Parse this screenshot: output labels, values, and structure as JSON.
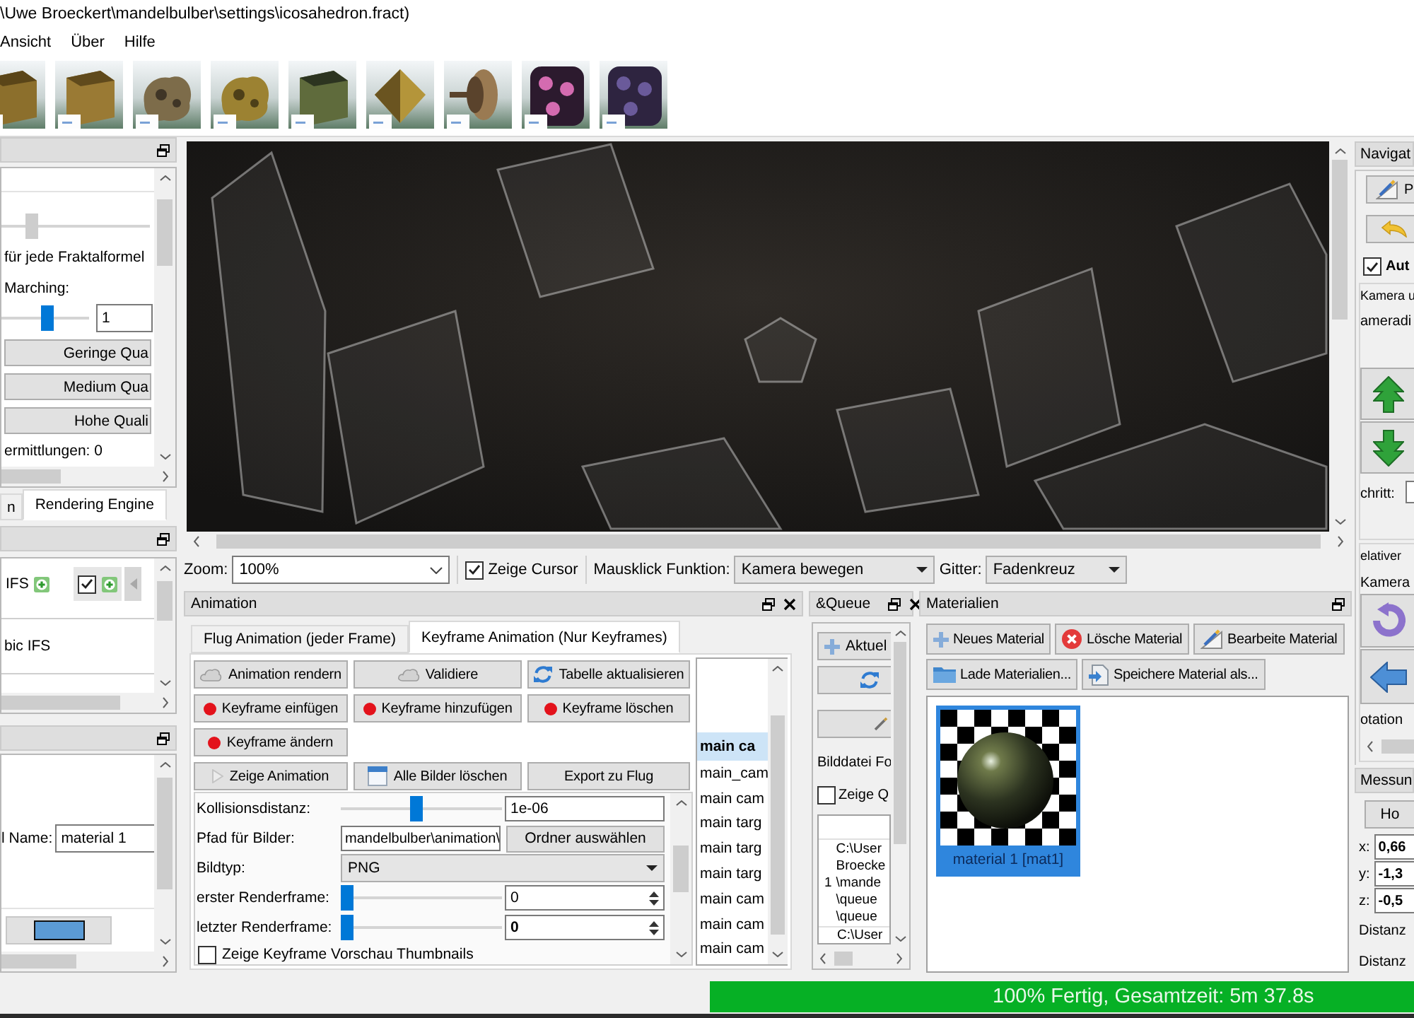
{
  "window": {
    "title": "\\Uwe Broeckert\\mandelbulber\\settings\\icosahedron.fract)"
  },
  "menu": [
    {
      "label": "Ansicht"
    },
    {
      "label": "Über"
    },
    {
      "label": "Hilfe"
    }
  ],
  "quality_panel": {
    "items": [
      {
        "kind": "slider",
        "level": 0.18,
        "disabled": true
      },
      {
        "kind": "text",
        "text": "für jede Fraktalformel"
      },
      {
        "kind": "text",
        "text": "Marching:"
      },
      {
        "kind": "slider_input",
        "level": 0.53,
        "disabled": false,
        "value": "1"
      },
      {
        "kind": "button",
        "label": "Geringe Qua"
      },
      {
        "kind": "button",
        "label": "Medium Qua"
      },
      {
        "kind": "button",
        "label": "Hohe Quali"
      },
      {
        "kind": "text",
        "text": "ermittlungen: 0"
      }
    ]
  },
  "left_tabs": [
    {
      "label": "n",
      "selected": false
    },
    {
      "label": "Rendering Engine",
      "selected": true
    }
  ],
  "formula_panel": {
    "tabs": [
      {
        "label": "IFS",
        "selected": true
      },
      {
        "selected": false,
        "checked": true
      }
    ],
    "list_item": "bic IFS"
  },
  "material_panel": {
    "name_label": "l Name:",
    "name_value": "material 1",
    "color": "#5b9bd5"
  },
  "view_toolbar": {
    "zoom": {
      "label": "Zoom:",
      "value": "100%"
    },
    "cursor": {
      "label": "Zeige Cursor",
      "checked": true
    },
    "mouse": {
      "label": "Mausklick Funktion:",
      "value": "Kamera bewegen"
    },
    "grid": {
      "label": "Gitter:",
      "value": "Fadenkreuz"
    }
  },
  "animation": {
    "title": "Animation",
    "tabs": [
      {
        "label": "Flug Animation (jeder Frame)",
        "selected": false
      },
      {
        "label": "Keyframe Animation (Nur Keyframes)",
        "selected": true
      }
    ],
    "buttons": [
      [
        {
          "label": "Animation rendern",
          "kind": "render"
        },
        {
          "label": "Validiere",
          "kind": "validate"
        },
        {
          "label": "Tabelle aktualisieren",
          "kind": "refresh"
        }
      ],
      [
        {
          "label": "Keyframe einfügen",
          "kind": "keyframe"
        },
        {
          "label": "Keyframe hinzufügen",
          "kind": "keyframe"
        },
        {
          "label": "Keyframe löschen",
          "kind": "keyframe"
        }
      ],
      [
        {
          "label": "Keyframe ändern",
          "kind": "keyframe"
        }
      ],
      [
        {
          "label": "Zeige Animation",
          "kind": "play"
        },
        {
          "label": "Alle Bilder löschen",
          "kind": "clear"
        },
        {
          "label": "Export zu Flug",
          "kind": "export"
        }
      ]
    ],
    "settings": [
      {
        "kind": "slider_field",
        "label": "Kollisionsdistanz:",
        "level": 0.47,
        "value": "1e-06"
      },
      {
        "kind": "path",
        "label": "Pfad für Bilder:",
        "value": "mandelbulber\\animation\\",
        "button": "Ordner auswählen"
      },
      {
        "kind": "combo",
        "label": "Bildtyp:",
        "value": "PNG"
      },
      {
        "kind": "slider_spin",
        "label": "erster Renderframe:",
        "level": 0,
        "value": "0",
        "modified": false
      },
      {
        "kind": "slider_spin",
        "label": "letzter Renderframe:",
        "level": 0,
        "value": "0",
        "modified": true
      },
      {
        "kind": "checkbox",
        "label": "Zeige Keyframe Vorschau Thumbnails",
        "checked": false
      }
    ],
    "keyframes": {
      "header": "main ca",
      "rows": [
        "main_cam",
        "main cam",
        "main targ",
        "main targ",
        "main targ",
        "main cam",
        "main cam",
        "main cam"
      ]
    }
  },
  "queue": {
    "title": "&Queue",
    "buttons": [
      {
        "label": "Aktuel",
        "kind": "add"
      },
      {
        "kind": "refresh"
      },
      {
        "kind": "tool"
      }
    ],
    "format_label": "Bilddatei Fo",
    "show_queue": {
      "label": "Zeige Q",
      "checked": false
    },
    "table": {
      "row_number": "1",
      "lines": [
        "C:\\User",
        "Broecke",
        "\\mande",
        "\\queue",
        "\\queue"
      ],
      "next_line": "C:\\User"
    }
  },
  "materials": {
    "title": "Materialien",
    "buttons": [
      [
        {
          "label": "Neues Material",
          "kind": "new"
        },
        {
          "label": "Lösche Material",
          "kind": "delete"
        },
        {
          "label": "Bearbeite Material",
          "kind": "edit"
        }
      ],
      [
        {
          "label": "Lade Materialien...",
          "kind": "load"
        },
        {
          "label": "Speichere Material als...",
          "kind": "save"
        }
      ]
    ],
    "items": [
      {
        "label": "material 1 [mat1]",
        "selected": true
      }
    ]
  },
  "navigation": {
    "title": "Navigat",
    "buttons": [
      {
        "label": "P",
        "kind": "edit"
      },
      {
        "kind": "undo"
      }
    ],
    "auto": {
      "label": "Aut",
      "checked": true
    },
    "camera_group": {
      "title": "Kamera u",
      "label": "ameradi",
      "step_label": "chritt:"
    },
    "relative_group": {
      "title": "elativer",
      "label": "Kamera",
      "rotation_label": "otation"
    }
  },
  "measurement": {
    "title": "Messun",
    "button": "Ho",
    "coords": [
      {
        "axis": "x:",
        "value": "0,66"
      },
      {
        "axis": "y:",
        "value": "-1,3"
      },
      {
        "axis": "z:",
        "value": "-0,5"
      }
    ],
    "distances": [
      "Distanz",
      "Distanz"
    ]
  },
  "status": {
    "text": "100% Fertig, Gesamtzeit: 5m 37.8s",
    "level": 1
  }
}
